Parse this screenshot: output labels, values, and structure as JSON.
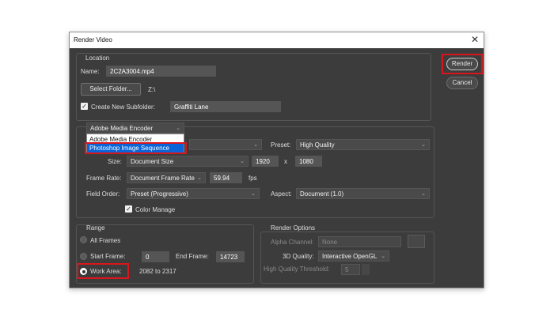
{
  "window": {
    "title": "Render Video",
    "close_glyph": "✕"
  },
  "location": {
    "group_label": "Location",
    "name_label": "Name:",
    "name_value": "2C2A3004.mp4",
    "select_folder_label": "Select Folder...",
    "folder_path": "Z:\\",
    "subfolder_checked": true,
    "subfolder_label": "Create New Subfolder:",
    "subfolder_value": "Graffiti Lane"
  },
  "encoder": {
    "selected": "Adobe Media Encoder",
    "options": [
      "Adobe Media Encoder",
      "Photoshop Image Sequence"
    ],
    "highlighted_option": "Photoshop Image Sequence"
  },
  "settings": {
    "preset_label": "Preset:",
    "preset_value": "High Quality",
    "size_label": "Size:",
    "size_value": "Document Size",
    "width": "1920",
    "x_label": "x",
    "height": "1080",
    "frame_rate_label": "Frame Rate:",
    "frame_rate_value": "Document Frame Rate",
    "fps_value": "59.94",
    "fps_label": "fps",
    "field_order_label": "Field Order:",
    "field_order_value": "Preset (Progressive)",
    "aspect_label": "Aspect:",
    "aspect_value": "Document (1.0)",
    "color_manage_checked": true,
    "color_manage_label": "Color Manage"
  },
  "range": {
    "group_label": "Range",
    "all_frames_label": "All Frames",
    "start_frame_label": "Start Frame:",
    "start_frame_value": "0",
    "end_frame_label": "End Frame:",
    "end_frame_value": "14723",
    "work_area_label": "Work Area:",
    "work_area_value": "2082 to 2317",
    "selected": "work_area"
  },
  "render_options": {
    "group_label": "Render Options",
    "alpha_label": "Alpha Channel:",
    "alpha_value": "None",
    "quality_3d_label": "3D Quality:",
    "quality_3d_value": "Interactive OpenGL",
    "threshold_label": "High Quality Threshold:",
    "threshold_value": "5"
  },
  "buttons": {
    "render_label": "Render",
    "cancel_label": "Cancel"
  },
  "icons": {
    "checkbox_check": "✓",
    "chevron": "⌄"
  },
  "colors": {
    "dialog_bg": "#3c3c3c",
    "highlight_red": "#d9161c",
    "selection_blue": "#0a64d8"
  }
}
